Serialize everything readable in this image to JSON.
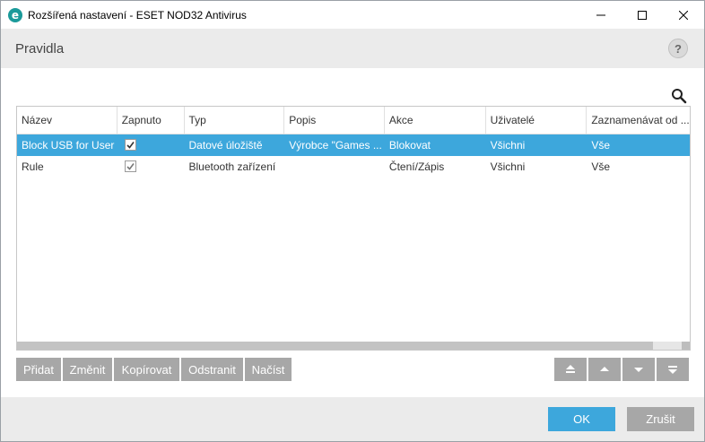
{
  "window": {
    "title": "Rozšířená nastavení - ESET NOD32 Antivirus",
    "app_icon_letter": "e"
  },
  "header": {
    "title": "Pravidla",
    "help_label": "?"
  },
  "table": {
    "columns": [
      "Název",
      "Zapnuto",
      "Typ",
      "Popis",
      "Akce",
      "Uživatelé",
      "Zaznamenávat od ..."
    ],
    "rows": [
      {
        "name": "Block USB for User",
        "enabled": true,
        "type": "Datové úložiště",
        "description": "Výrobce \"Games ...",
        "action": "Blokovat",
        "users": "Všichni",
        "log": "Vše",
        "selected": true
      },
      {
        "name": "Rule",
        "enabled": true,
        "type": "Bluetooth zařízení",
        "description": "",
        "action": "Čtení/Zápis",
        "users": "Všichni",
        "log": "Vše",
        "selected": false
      }
    ]
  },
  "toolbar": {
    "add_label": "Přidat",
    "edit_label": "Změnit",
    "copy_label": "Kopírovat",
    "remove_label": "Odstranit",
    "load_label": "Načíst"
  },
  "footer": {
    "ok_label": "OK",
    "cancel_label": "Zrušit"
  },
  "colors": {
    "accent": "#3da7dc",
    "button_gray": "#a7a7a7",
    "brand": "#1b9a9a"
  },
  "icons": {
    "search": "search-icon",
    "move_top": "double-chevron-up-icon",
    "move_up": "chevron-up-icon",
    "move_down": "chevron-down-icon",
    "move_bottom": "double-chevron-down-icon"
  }
}
